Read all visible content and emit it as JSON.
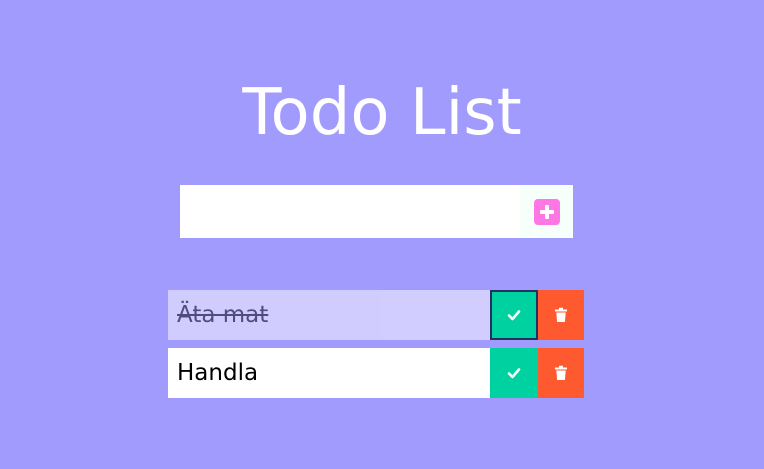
{
  "app": {
    "title": "Todo List"
  },
  "colors": {
    "background": "#a29bfe",
    "add_button": "#ff77e4",
    "complete": "#00d1a0",
    "delete": "#ff5a2f",
    "text": "#000000",
    "title": "#ffffff"
  },
  "form": {
    "input_value": "",
    "placeholder": "",
    "add_icon": "plus-square-icon"
  },
  "todos": [
    {
      "text": "Äta mat",
      "completed": true,
      "complete_icon": "check-icon",
      "delete_icon": "trash-icon"
    },
    {
      "text": "Handla",
      "completed": false,
      "complete_icon": "check-icon",
      "delete_icon": "trash-icon"
    }
  ]
}
